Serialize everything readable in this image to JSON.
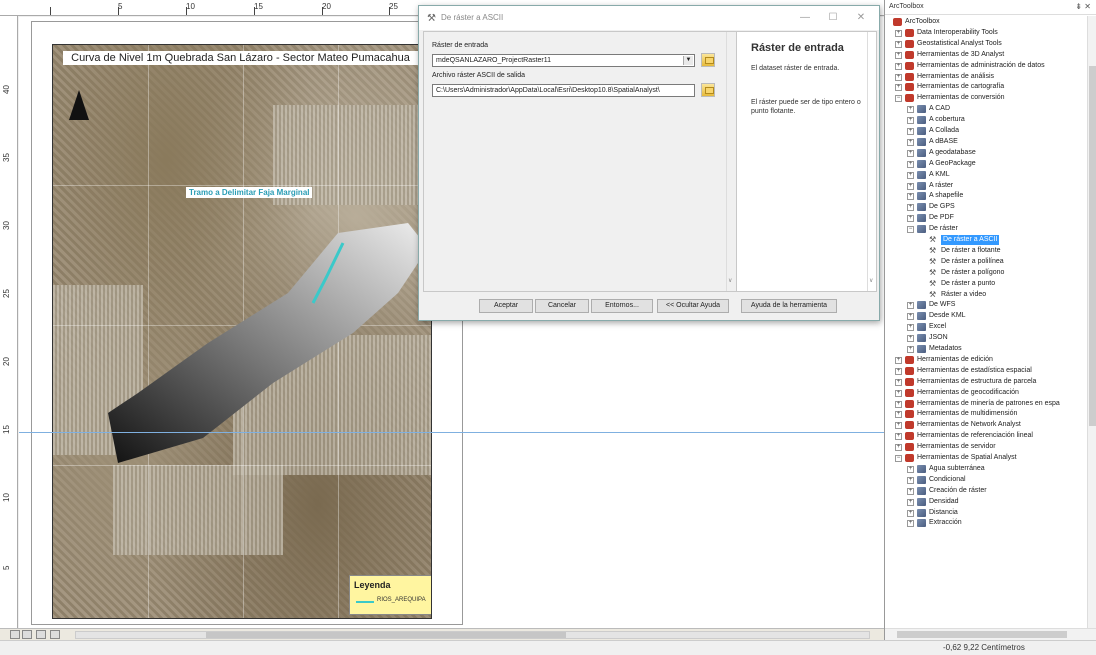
{
  "ruler": {
    "top_ticks": [
      "5",
      "10",
      "15",
      "20",
      "25"
    ],
    "left_ticks": [
      "40",
      "35",
      "30",
      "25",
      "20",
      "15",
      "10",
      "5"
    ]
  },
  "map": {
    "title": "Curva de Nivel 1m Quebrada San Lázaro - Sector Mateo Pumacahua",
    "tramo_label": "Tramo a Delimitar Faja Marginal",
    "legend_title": "Leyenda",
    "legend_item": "RIOS_AREQUIPA",
    "legend_color": "#3bc9c9"
  },
  "dialog": {
    "title": "De ráster a ASCII",
    "minimize": "—",
    "maximize": "☐",
    "close": "✕",
    "raster_label": "Ráster de entrada",
    "raster_value": "mdeQSANLAZARO_ProjectRaster11",
    "ascii_label": "Archivo ráster ASCII de salida",
    "ascii_value": "C:\\Users\\Administrador\\AppData\\Local\\Esri\\Desktop10.8\\SpatialAnalyst\\",
    "help_title": "Ráster de entrada",
    "help_p1": "El dataset ráster de entrada.",
    "help_p2": "El ráster puede ser de tipo entero o punto flotante.",
    "buttons": {
      "ok": "Aceptar",
      "cancel": "Cancelar",
      "env": "Entornos...",
      "hide_help": "<< Ocultar Ayuda",
      "tool_help": "Ayuda de la herramienta"
    }
  },
  "toolbox": {
    "header": "ArcToolbox",
    "controls": "⇟ ✕",
    "items": [
      {
        "level": 0,
        "kind": "root",
        "exp": "",
        "label": "ArcToolbox"
      },
      {
        "level": 1,
        "kind": "tb",
        "exp": "+",
        "label": "Data Interoperability Tools"
      },
      {
        "level": 1,
        "kind": "tb",
        "exp": "+",
        "label": "Geostatistical Analyst Tools"
      },
      {
        "level": 1,
        "kind": "tb",
        "exp": "+",
        "label": "Herramientas de 3D Analyst"
      },
      {
        "level": 1,
        "kind": "tb",
        "exp": "+",
        "label": "Herramientas de administración de datos"
      },
      {
        "level": 1,
        "kind": "tb",
        "exp": "+",
        "label": "Herramientas de análisis"
      },
      {
        "level": 1,
        "kind": "tb",
        "exp": "+",
        "label": "Herramientas de cartografía"
      },
      {
        "level": 1,
        "kind": "tb",
        "exp": "−",
        "label": "Herramientas de conversión"
      },
      {
        "level": 2,
        "kind": "ts",
        "exp": "+",
        "label": "A CAD"
      },
      {
        "level": 2,
        "kind": "ts",
        "exp": "+",
        "label": "A cobertura"
      },
      {
        "level": 2,
        "kind": "ts",
        "exp": "+",
        "label": "A Collada"
      },
      {
        "level": 2,
        "kind": "ts",
        "exp": "+",
        "label": "A dBASE"
      },
      {
        "level": 2,
        "kind": "ts",
        "exp": "+",
        "label": "A geodatabase"
      },
      {
        "level": 2,
        "kind": "ts",
        "exp": "+",
        "label": "A GeoPackage"
      },
      {
        "level": 2,
        "kind": "ts",
        "exp": "+",
        "label": "A KML"
      },
      {
        "level": 2,
        "kind": "ts",
        "exp": "+",
        "label": "A ráster"
      },
      {
        "level": 2,
        "kind": "ts",
        "exp": "+",
        "label": "A shapefile"
      },
      {
        "level": 2,
        "kind": "ts",
        "exp": "+",
        "label": "De GPS"
      },
      {
        "level": 2,
        "kind": "ts",
        "exp": "+",
        "label": "De PDF"
      },
      {
        "level": 2,
        "kind": "ts",
        "exp": "−",
        "label": "De ráster"
      },
      {
        "level": 3,
        "kind": "tool",
        "exp": "",
        "label": "De ráster a ASCII",
        "selected": true
      },
      {
        "level": 3,
        "kind": "tool",
        "exp": "",
        "label": "De ráster a flotante"
      },
      {
        "level": 3,
        "kind": "tool",
        "exp": "",
        "label": "De ráster a polilínea"
      },
      {
        "level": 3,
        "kind": "tool",
        "exp": "",
        "label": "De ráster a polígono"
      },
      {
        "level": 3,
        "kind": "tool",
        "exp": "",
        "label": "De ráster a punto"
      },
      {
        "level": 3,
        "kind": "tool",
        "exp": "",
        "label": "Ráster a video"
      },
      {
        "level": 2,
        "kind": "ts",
        "exp": "+",
        "label": "De WFS"
      },
      {
        "level": 2,
        "kind": "ts",
        "exp": "+",
        "label": "Desde KML"
      },
      {
        "level": 2,
        "kind": "ts",
        "exp": "+",
        "label": "Excel"
      },
      {
        "level": 2,
        "kind": "ts",
        "exp": "+",
        "label": "JSON"
      },
      {
        "level": 2,
        "kind": "ts",
        "exp": "+",
        "label": "Metadatos"
      },
      {
        "level": 1,
        "kind": "tb",
        "exp": "+",
        "label": "Herramientas de edición"
      },
      {
        "level": 1,
        "kind": "tb",
        "exp": "+",
        "label": "Herramientas de estadística espacial"
      },
      {
        "level": 1,
        "kind": "tb",
        "exp": "+",
        "label": "Herramientas de estructura de parcela"
      },
      {
        "level": 1,
        "kind": "tb",
        "exp": "+",
        "label": "Herramientas de geocodificación"
      },
      {
        "level": 1,
        "kind": "tb",
        "exp": "+",
        "label": "Herramientas de minería de patrones en espa"
      },
      {
        "level": 1,
        "kind": "tb",
        "exp": "+",
        "label": "Herramientas de multidimensión"
      },
      {
        "level": 1,
        "kind": "tb",
        "exp": "+",
        "label": "Herramientas de Network Analyst"
      },
      {
        "level": 1,
        "kind": "tb",
        "exp": "+",
        "label": "Herramientas de referenciación lineal"
      },
      {
        "level": 1,
        "kind": "tb",
        "exp": "+",
        "label": "Herramientas de servidor"
      },
      {
        "level": 1,
        "kind": "tb",
        "exp": "−",
        "label": "Herramientas de Spatial Analyst"
      },
      {
        "level": 2,
        "kind": "ts",
        "exp": "+",
        "label": "Agua subterránea"
      },
      {
        "level": 2,
        "kind": "ts",
        "exp": "+",
        "label": "Condicional"
      },
      {
        "level": 2,
        "kind": "ts",
        "exp": "+",
        "label": "Creación de ráster"
      },
      {
        "level": 2,
        "kind": "ts",
        "exp": "+",
        "label": "Densidad"
      },
      {
        "level": 2,
        "kind": "ts",
        "exp": "+",
        "label": "Distancia"
      },
      {
        "level": 2,
        "kind": "ts",
        "exp": "+",
        "label": "Extracción"
      }
    ]
  },
  "status": {
    "coordinates": "-0,62  9,22 Centímetros"
  }
}
